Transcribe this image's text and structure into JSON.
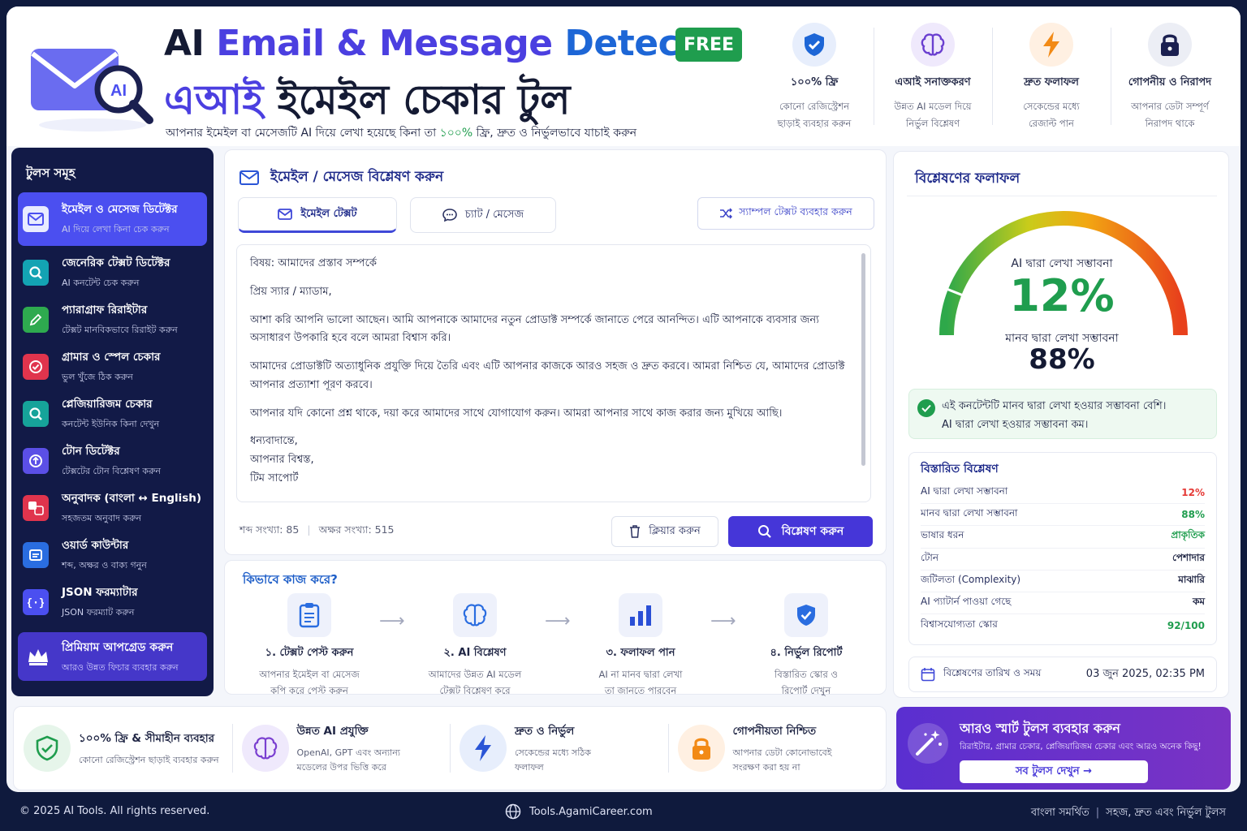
{
  "header": {
    "title_en_1": "AI",
    "title_en_2": "Email & Message",
    "title_en_3": "Detector",
    "free_badge": "FREE",
    "title_bn_hl": "এআই",
    "title_bn_rest": "ইমেইল চেকার টুল",
    "subtitle_a": "আপনার ইমেইল বা মেসেজটি AI দিয়ে লেখা হয়েছে কিনা তা",
    "subtitle_pct": "১০০%",
    "subtitle_b": "ফ্রি, দ্রুত ও নির্ভুলভাবে যাচাই করুন",
    "logo_badge": "AI",
    "features": [
      {
        "title": "১০০% ফ্রি",
        "desc1": "কোনো রেজিস্ট্রেশন",
        "desc2": "ছাড়াই ব্যবহার করুন"
      },
      {
        "title": "এআই সনাক্তকরণ",
        "desc1": "উন্নত AI মডেল দিয়ে",
        "desc2": "নির্ভুল বিশ্লেষণ"
      },
      {
        "title": "দ্রুত ফলাফল",
        "desc1": "সেকেন্ডের মধ্যে",
        "desc2": "রেজাল্ট পান"
      },
      {
        "title": "গোপনীয় ও নিরাপদ",
        "desc1": "আপনার ডেটা সম্পূর্ণ",
        "desc2": "নিরাপদ থাকে"
      }
    ]
  },
  "sidebar": {
    "title": "টুলস সমূহ",
    "items": [
      {
        "title": "ইমেইল ও মেসেজ ডিটেক্টর",
        "desc": "AI দিয়ে লেখা কিনা চেক করুন"
      },
      {
        "title": "জেনেরিক টেক্সট ডিটেক্টর",
        "desc": "AI কনটেন্ট চেক করুন"
      },
      {
        "title": "প্যারাগ্রাফ রিরাইটার",
        "desc": "টেক্সট মানবিকভাবে রিরাইট করুন"
      },
      {
        "title": "গ্রামার ও স্পেল চেকার",
        "desc": "ভুল খুঁজে ঠিক করুন"
      },
      {
        "title": "প্লেজিয়ারিজম চেকার",
        "desc": "কনটেন্ট ইউনিক কিনা দেখুন"
      },
      {
        "title": "টোন ডিটেক্টর",
        "desc": "টেক্সটের টোন বিশ্লেষণ করুন"
      },
      {
        "title": "অনুবাদক (বাংলা ↔ English)",
        "desc": "সহজতম অনুবাদ করুন"
      },
      {
        "title": "ওয়ার্ড কাউন্টার",
        "desc": "শব্দ, অক্ষর ও বাক্য গনুন"
      },
      {
        "title": "JSON ফরম্যাটার",
        "desc": "JSON ফরম্যাট করুন"
      }
    ],
    "premium_title": "প্রিমিয়াম আপগ্রেড করুন",
    "premium_desc": "আরও উন্নত ফিচার ব্যবহার করুন"
  },
  "editor": {
    "heading": "ইমেইল / মেসেজ বিশ্লেষণ করুন",
    "tab_email": "ইমেইল টেক্সট",
    "tab_chat": "চ্যাট / মেসেজ",
    "sample_btn": "স্যাম্পল টেক্সট ব্যবহার করুন",
    "lines": [
      "বিষয়: আমাদের প্রস্তাব সম্পর্কে",
      "প্রিয় স্যার / ম্যাডাম,",
      "আশা করি আপনি ভালো আছেন। আমি আপনাকে আমাদের নতুন প্রোডাক্ট সম্পর্কে জানাতে পেরে আনন্দিত। এটি আপনাকে ব্যবসার জন্য অসাধারণ উপকারি হবে বলে আমরা বিশ্বাস করি।",
      "আমাদের প্রোডাক্টটি অত্যাধুনিক প্রযুক্তি দিয়ে তৈরি এবং এটি আপনার কাজকে আরও সহজ ও দ্রুত করবে। আমরা নিশ্চিত যে, আমাদের প্রোডাক্ট আপনার প্রত্যাশা পূরণ করবে।",
      "আপনার যদি কোনো প্রশ্ন থাকে, দয়া করে আমাদের সাথে যোগাযোগ করুন। আমরা আপনার সাথে কাজ করার জন্য মুখিয়ে আছি।",
      "ধন্যবাদান্তে,",
      "আপনার বিশ্বস্ত,",
      "টিম সাপোর্ট"
    ],
    "word_count": "শব্দ সংখ্যা: 85",
    "char_count": "অক্ষর সংখ্যা: 515",
    "clear_btn": "ক্লিয়ার করুন",
    "analyze_btn": "বিশ্লেষণ করুন"
  },
  "how": {
    "title": "কিভাবে কাজ করে?",
    "steps": [
      {
        "title": "১. টেক্সট পেস্ট করুন",
        "desc1": "আপনার ইমেইল বা মেসেজ",
        "desc2": "কপি করে পেস্ট করুন"
      },
      {
        "title": "২. AI বিশ্লেষণ",
        "desc1": "আমাদের উন্নত AI মডেল",
        "desc2": "টেক্সট বিশ্লেষণ করে"
      },
      {
        "title": "৩. ফলাফল পান",
        "desc1": "AI না মানব দ্বারা লেখা",
        "desc2": "তা জানতে পারবেন"
      },
      {
        "title": "৪. নির্ভুল রিপোর্ট",
        "desc1": "বিস্তারিত স্কোর ও",
        "desc2": "রিপোর্ট দেখুন"
      }
    ]
  },
  "results": {
    "title": "বিশ্লেষণের ফলাফল",
    "ai_label": "AI দ্বারা লেখা সম্ভাবনা",
    "ai_value": "12%",
    "ai_fraction": 0.12,
    "human_label": "মানব দ্বারা লেখা সম্ভাবনা",
    "human_value": "88%",
    "verdict1": "এই কনটেন্টটি মানব দ্বারা লেখা হওয়ার সম্ভাবনা বেশি।",
    "verdict2": "AI দ্বারা লেখা হওয়ার সম্ভাবনা কম।",
    "detail_title": "বিস্তারিত বিশ্লেষণ",
    "rows": [
      {
        "label": "AI দ্বারা লেখা সম্ভাবনা",
        "value": "12%",
        "color": "#e53935"
      },
      {
        "label": "মানব দ্বারা লেখা সম্ভাবনা",
        "value": "88%",
        "color": "#1f9d4e"
      },
      {
        "label": "ভাষার ধরন",
        "value": "প্রাকৃতিক",
        "color": "#1f9d4e"
      },
      {
        "label": "টোন",
        "value": "পেশাদার",
        "color": "#1f2544"
      },
      {
        "label": "জটিলতা (Complexity)",
        "value": "মাঝারি",
        "color": "#1f2544"
      },
      {
        "label": "AI প্যাটার্ন পাওয়া গেছে",
        "value": "কম",
        "color": "#1f2544"
      },
      {
        "label": "বিশ্বাসযোগ্যতা স্কোর",
        "value": "92/100",
        "color": "#1f9d4e"
      }
    ],
    "date_label": "বিশ্লেষণের তারিখ ও সময়",
    "date_value": "03 জুন 2025, 02:35 PM"
  },
  "bottom": {
    "features": [
      {
        "title": "১০০% ফ্রি & সীমাহীন ব্যবহার",
        "desc1": "কোনো রেজিস্ট্রেশন ছাড়াই ব্যবহার করুন",
        "desc2": ""
      },
      {
        "title": "উন্নত AI প্রযুক্তি",
        "desc1": "OpenAI, GPT এবং অন্যান্য",
        "desc2": "মডেলের উপর ভিত্তি করে"
      },
      {
        "title": "দ্রুত ও নির্ভুল",
        "desc1": "সেকেন্ডের মধ্যে সঠিক",
        "desc2": "ফলাফল"
      },
      {
        "title": "গোপনীয়তা নিশ্চিত",
        "desc1": "আপনার ডেটা কোনোভাবেই",
        "desc2": "সংরক্ষণ করা হয় না"
      }
    ],
    "promo_title": "আরও স্মার্ট টুলস ব্যবহার করুন",
    "promo_desc": "রিরাইটার, গ্রামার চেকার, প্লেজিয়ারিজম চেকার এবং আরও অনেক কিছু!",
    "promo_btn": "সব টুলস দেখুন →"
  },
  "footer": {
    "copyright": "© 2025 AI Tools. All rights reserved.",
    "site": "Tools.AgamiCareer.com",
    "right1": "বাংলা সমর্থিত",
    "right2": "সহজ, দ্রুত এবং নির্ভুল টুলস"
  },
  "colors": {
    "brand": "#4b3fe0",
    "accent_blue": "#1d66d6",
    "success": "#1f9d4e",
    "sidebar_bg": "#121a47",
    "danger": "#e53935"
  }
}
